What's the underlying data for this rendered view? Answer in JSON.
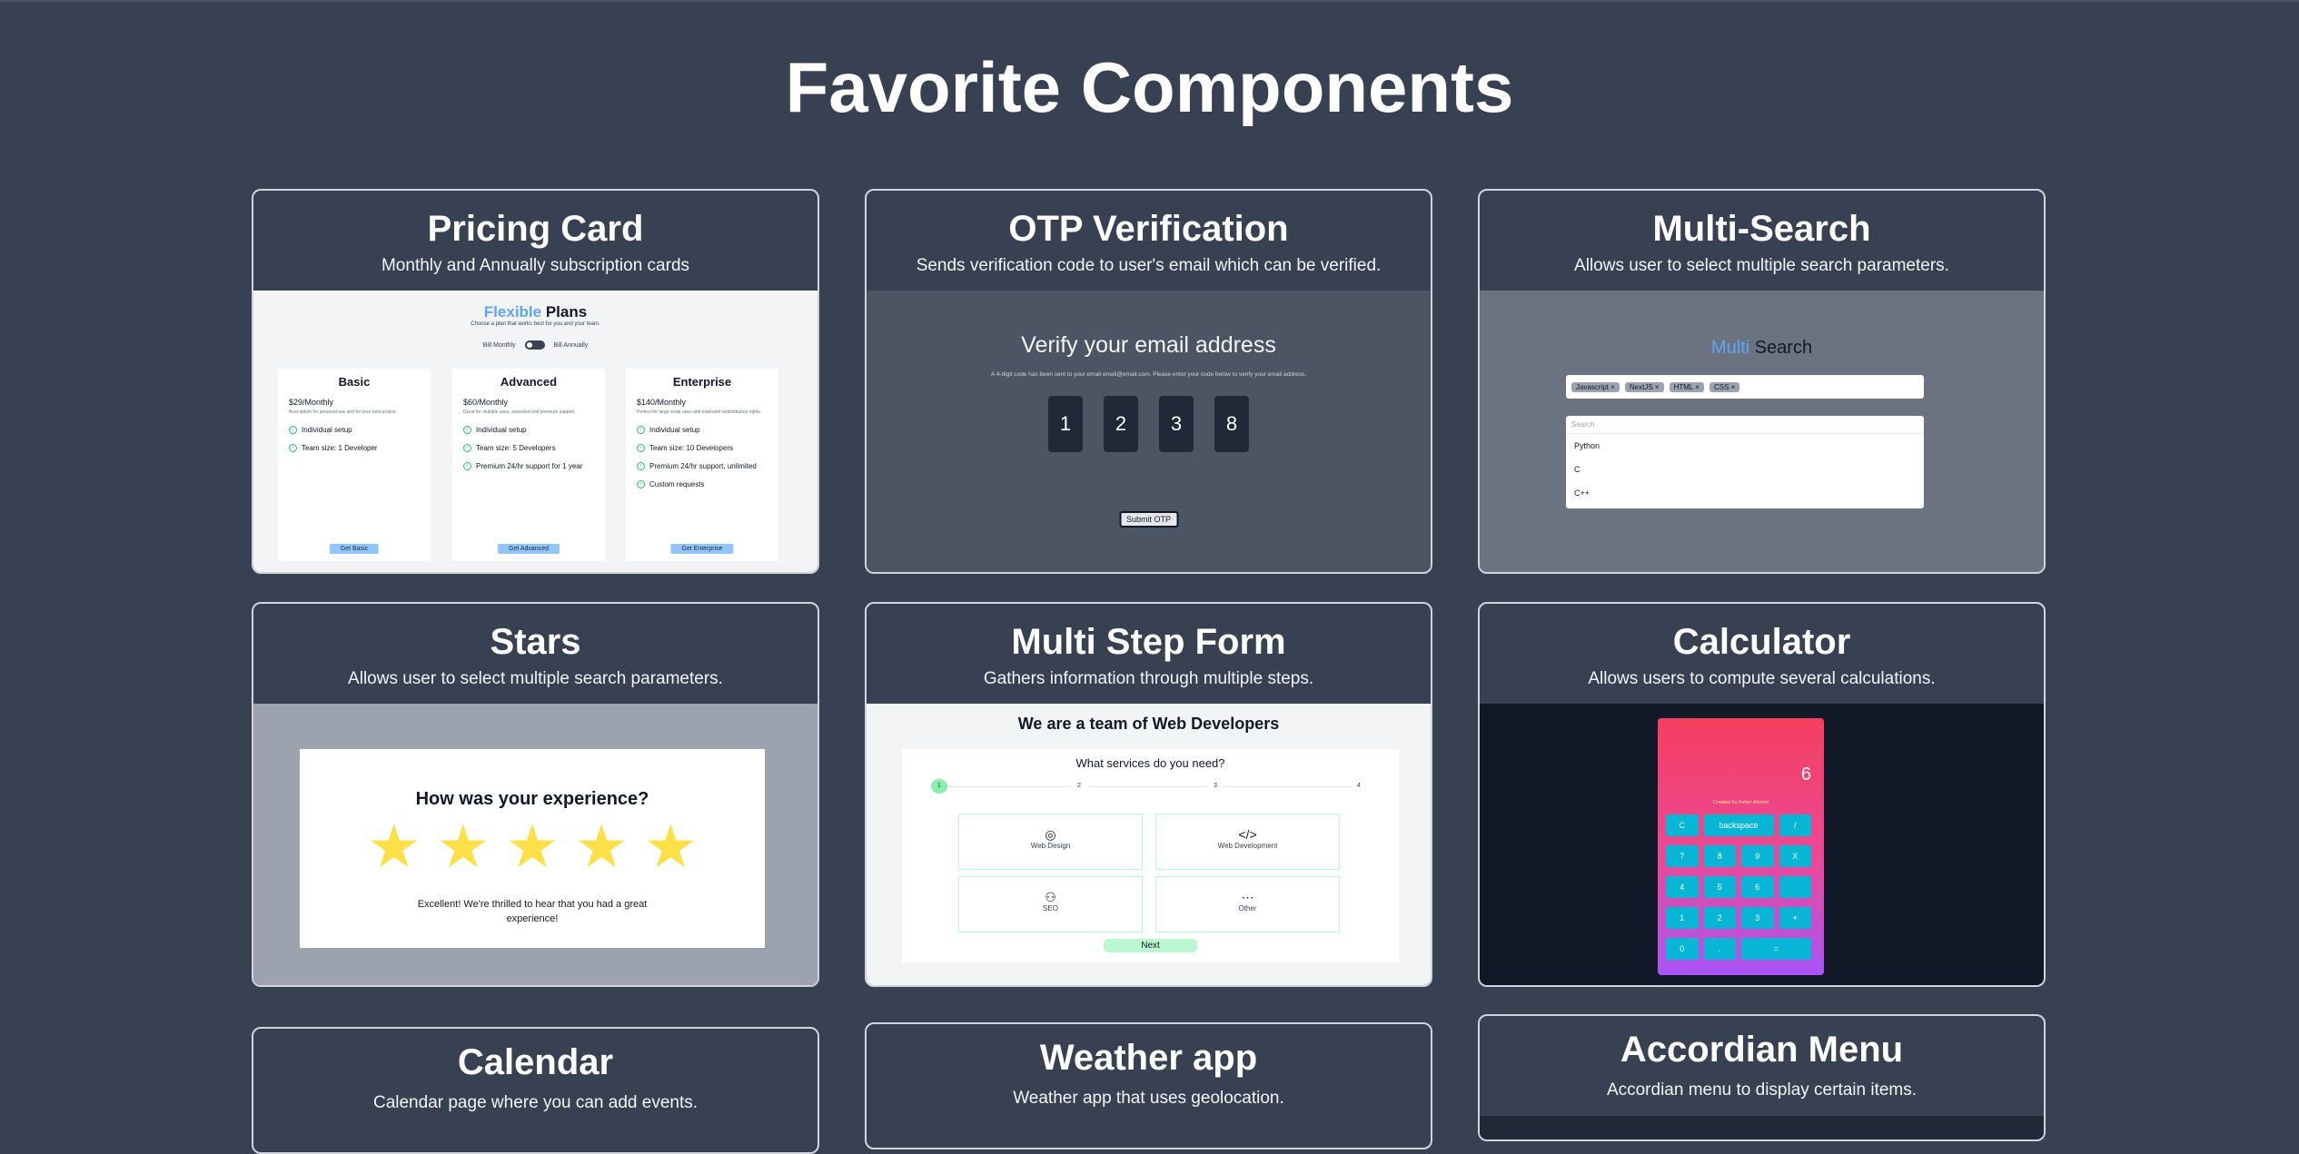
{
  "page": {
    "title": "Favorite Components"
  },
  "cards": {
    "pricing": {
      "title": "Pricing Card",
      "desc": "Monthly and Annually subscription cards"
    },
    "otp": {
      "title": "OTP Verification",
      "desc": "Sends verification code to user's email which can be verified."
    },
    "multisearch": {
      "title": "Multi-Search",
      "desc": "Allows user to select multiple search parameters."
    },
    "stars": {
      "title": "Stars",
      "desc": "Allows user to select multiple search parameters."
    },
    "multistep": {
      "title": "Multi Step Form",
      "desc": "Gathers information through multiple steps."
    },
    "calculator": {
      "title": "Calculator",
      "desc": "Allows users to compute several calculations."
    },
    "calendar": {
      "title": "Calendar",
      "desc": "Calendar page where you can add events."
    },
    "weather": {
      "title": "Weather app",
      "desc": "Weather app that uses geolocation."
    },
    "accordian": {
      "title": "Accordian Menu",
      "desc": "Accordian menu to display certain items."
    }
  },
  "pricing": {
    "title_accent": "Flexible",
    "title_rest": "Plans",
    "subtitle": "Choose a plan that works best for you and your team.",
    "bill_monthly": "Bill Monthly",
    "bill_annually": "Bill Annually",
    "plans": [
      {
        "name": "Basic",
        "price": "$29/Monthly",
        "desc": "Best option for personal use and for your next project.",
        "features": [
          "Individual setup",
          "Team size: 1 Developer"
        ],
        "button": "Get Basic"
      },
      {
        "name": "Advanced",
        "price": "$60/Monthly",
        "desc": "Great for multiple uses, extended and premium support.",
        "features": [
          "Individual setup",
          "Team size: 5 Developers",
          "Premium 24/hr support for 1 year"
        ],
        "button": "Get Advanced"
      },
      {
        "name": "Enterprise",
        "price": "$140/Monthly",
        "desc": "Perfect for large scale uses and extended redistribution rights.",
        "features": [
          "Individual setup",
          "Team size: 10 Developers",
          "Premium 24/hr support, unlimited",
          "Custom requests"
        ],
        "button": "Get Enterprise"
      }
    ]
  },
  "otp": {
    "heading": "Verify your email address",
    "text": "A 4-digit code has been sent to your email email@email.com. Please enter your code below to verify your email address.",
    "digits": [
      "1",
      "2",
      "3",
      "8"
    ],
    "submit": "Submit OTP"
  },
  "multisearch": {
    "title_accent": "Multi",
    "title_rest": "Search",
    "tags": [
      "Javascript ×",
      "NextJS ×",
      "HTML ×",
      "CSS ×"
    ],
    "search_placeholder": "Search",
    "options": [
      "Python",
      "C",
      "C++"
    ]
  },
  "stars": {
    "heading": "How was your experience?",
    "rating": 5,
    "max": 5,
    "message": "Excellent! We're thrilled to hear that you had a great experience!"
  },
  "multistep": {
    "heading": "We are a team of Web Developers",
    "question": "What services do you need?",
    "steps": [
      "1",
      "2",
      "3",
      "4"
    ],
    "active_step": 1,
    "options": [
      {
        "icon": "◎",
        "label": "Web Design"
      },
      {
        "icon": "</>",
        "label": "Web Development"
      },
      {
        "icon": "⚇",
        "label": "SEO"
      },
      {
        "icon": "⋯",
        "label": "Other"
      }
    ],
    "next": "Next"
  },
  "calculator": {
    "display": "6",
    "credit": "Created by Asher Ahmed",
    "keys": [
      "C",
      "backspace",
      "/",
      "7",
      "8",
      "9",
      "X",
      "4",
      "5",
      "6",
      "",
      "1",
      "2",
      "3",
      "+",
      "0",
      ".",
      "="
    ]
  }
}
